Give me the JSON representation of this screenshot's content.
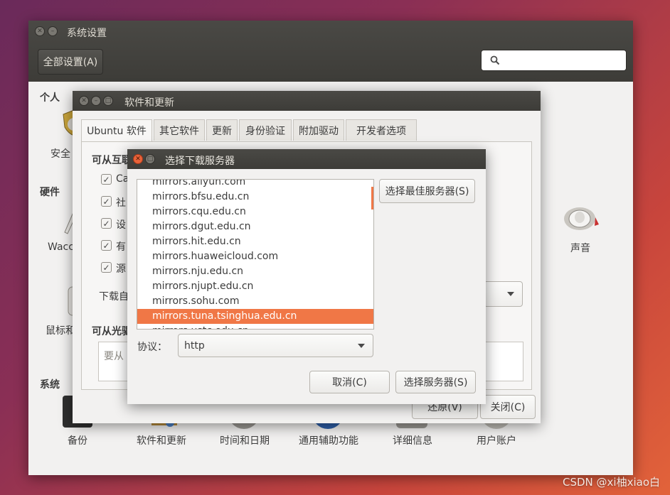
{
  "settings": {
    "title": "系统设置",
    "all_settings_button": "全部设置(A)",
    "section_personal": "个人",
    "section_hardware": "硬件",
    "section_system": "系统",
    "item_security": "安全",
    "item_wacom": "Wacc",
    "item_mouse": "鼠标和",
    "item_sound": "声音",
    "bottom_items": [
      "备份",
      "软件和更新",
      "时间和日期",
      "通用辅助功能",
      "详细信息",
      "用户账户"
    ]
  },
  "software": {
    "title": "软件和更新",
    "tabs": [
      "Ubuntu 软件",
      "其它软件",
      "更新",
      "身份验证",
      "附加驱动",
      "开发者选项"
    ],
    "section_internet": "可从互联",
    "checkbox_labels": [
      "Ca",
      "社",
      "设",
      "有",
      "源"
    ],
    "download_from_label": "下载自",
    "section_cdrom": "可从光驱",
    "cdrom_placeholder": "要从",
    "revert_button": "还原(V)",
    "close_button": "关闭(C)"
  },
  "dialog": {
    "title": "选择下载服务器",
    "mirrors": [
      "mirrors.aliyun.com",
      "mirrors.bfsu.edu.cn",
      "mirrors.cqu.edu.cn",
      "mirrors.dgut.edu.cn",
      "mirrors.hit.edu.cn",
      "mirrors.huaweicloud.com",
      "mirrors.nju.edu.cn",
      "mirrors.njupt.edu.cn",
      "mirrors.sohu.com",
      "mirrors.tuna.tsinghua.edu.cn",
      "mirrors.ustc.edu.cn"
    ],
    "selected_mirror": "mirrors.tuna.tsinghua.edu.cn",
    "best_server_button": "选择最佳服务器(S)",
    "protocol_label": "协议：",
    "protocol_value": "http",
    "cancel_button": "取消(C)",
    "choose_server_button": "选择服务器(S)"
  },
  "watermark": "CSDN @xi柚xiao白",
  "colors": {
    "accent": "#f07746",
    "titlebar": "#3d3c38",
    "window_bg": "#f2f1f0"
  }
}
